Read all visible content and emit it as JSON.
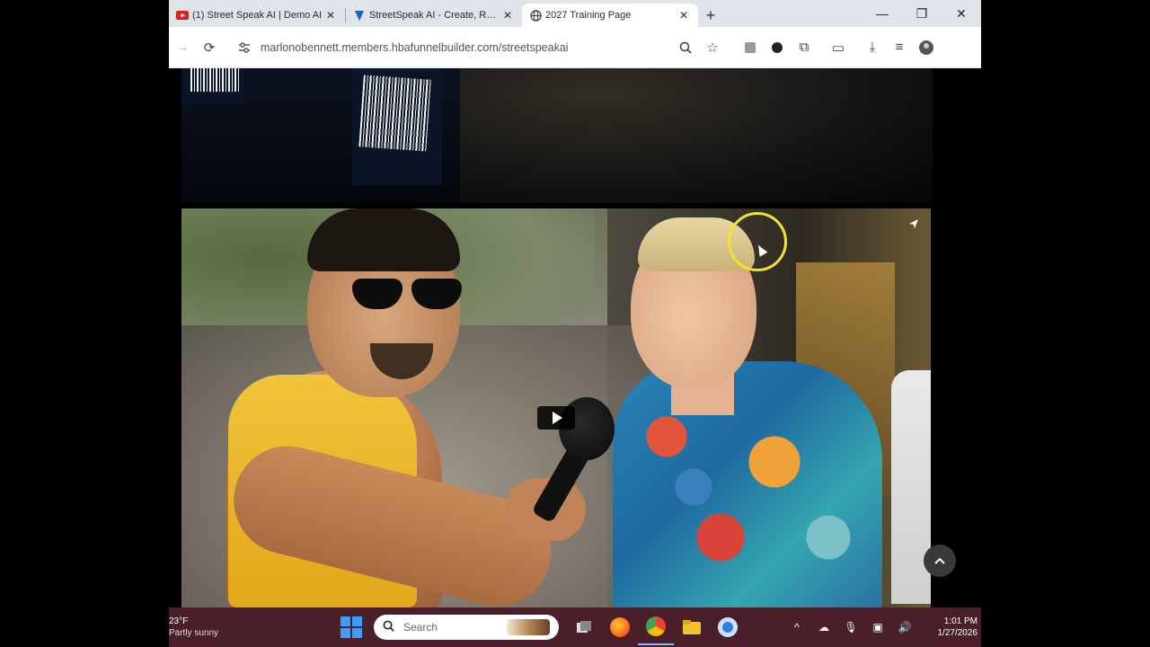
{
  "browser": {
    "tabs": [
      {
        "title": "(1) Street Speak AI | Demo AI",
        "active": false
      },
      {
        "title": "StreetSpeak AI - Create, Rank",
        "active": false
      },
      {
        "title": "2027 Training Page",
        "active": true
      }
    ],
    "new_tab_icon": "plus",
    "url": "marlonobennett.members.hbafunnelbuilder.com/streetspeakai"
  },
  "video": {
    "play_icon": "play-icon",
    "share_icon": "share-icon",
    "scroll_top_icon": "chevron-up-icon"
  },
  "taskbar": {
    "weather_temp": "23°F",
    "weather_condition": "Partly sunny",
    "search_placeholder": "Search",
    "time": "1:01 PM",
    "date": "1/27/2026"
  },
  "colors": {
    "taskbar": "#4a1f2a",
    "tabbar": "#dfe3ea",
    "cursor_ring": "#f3e230"
  }
}
